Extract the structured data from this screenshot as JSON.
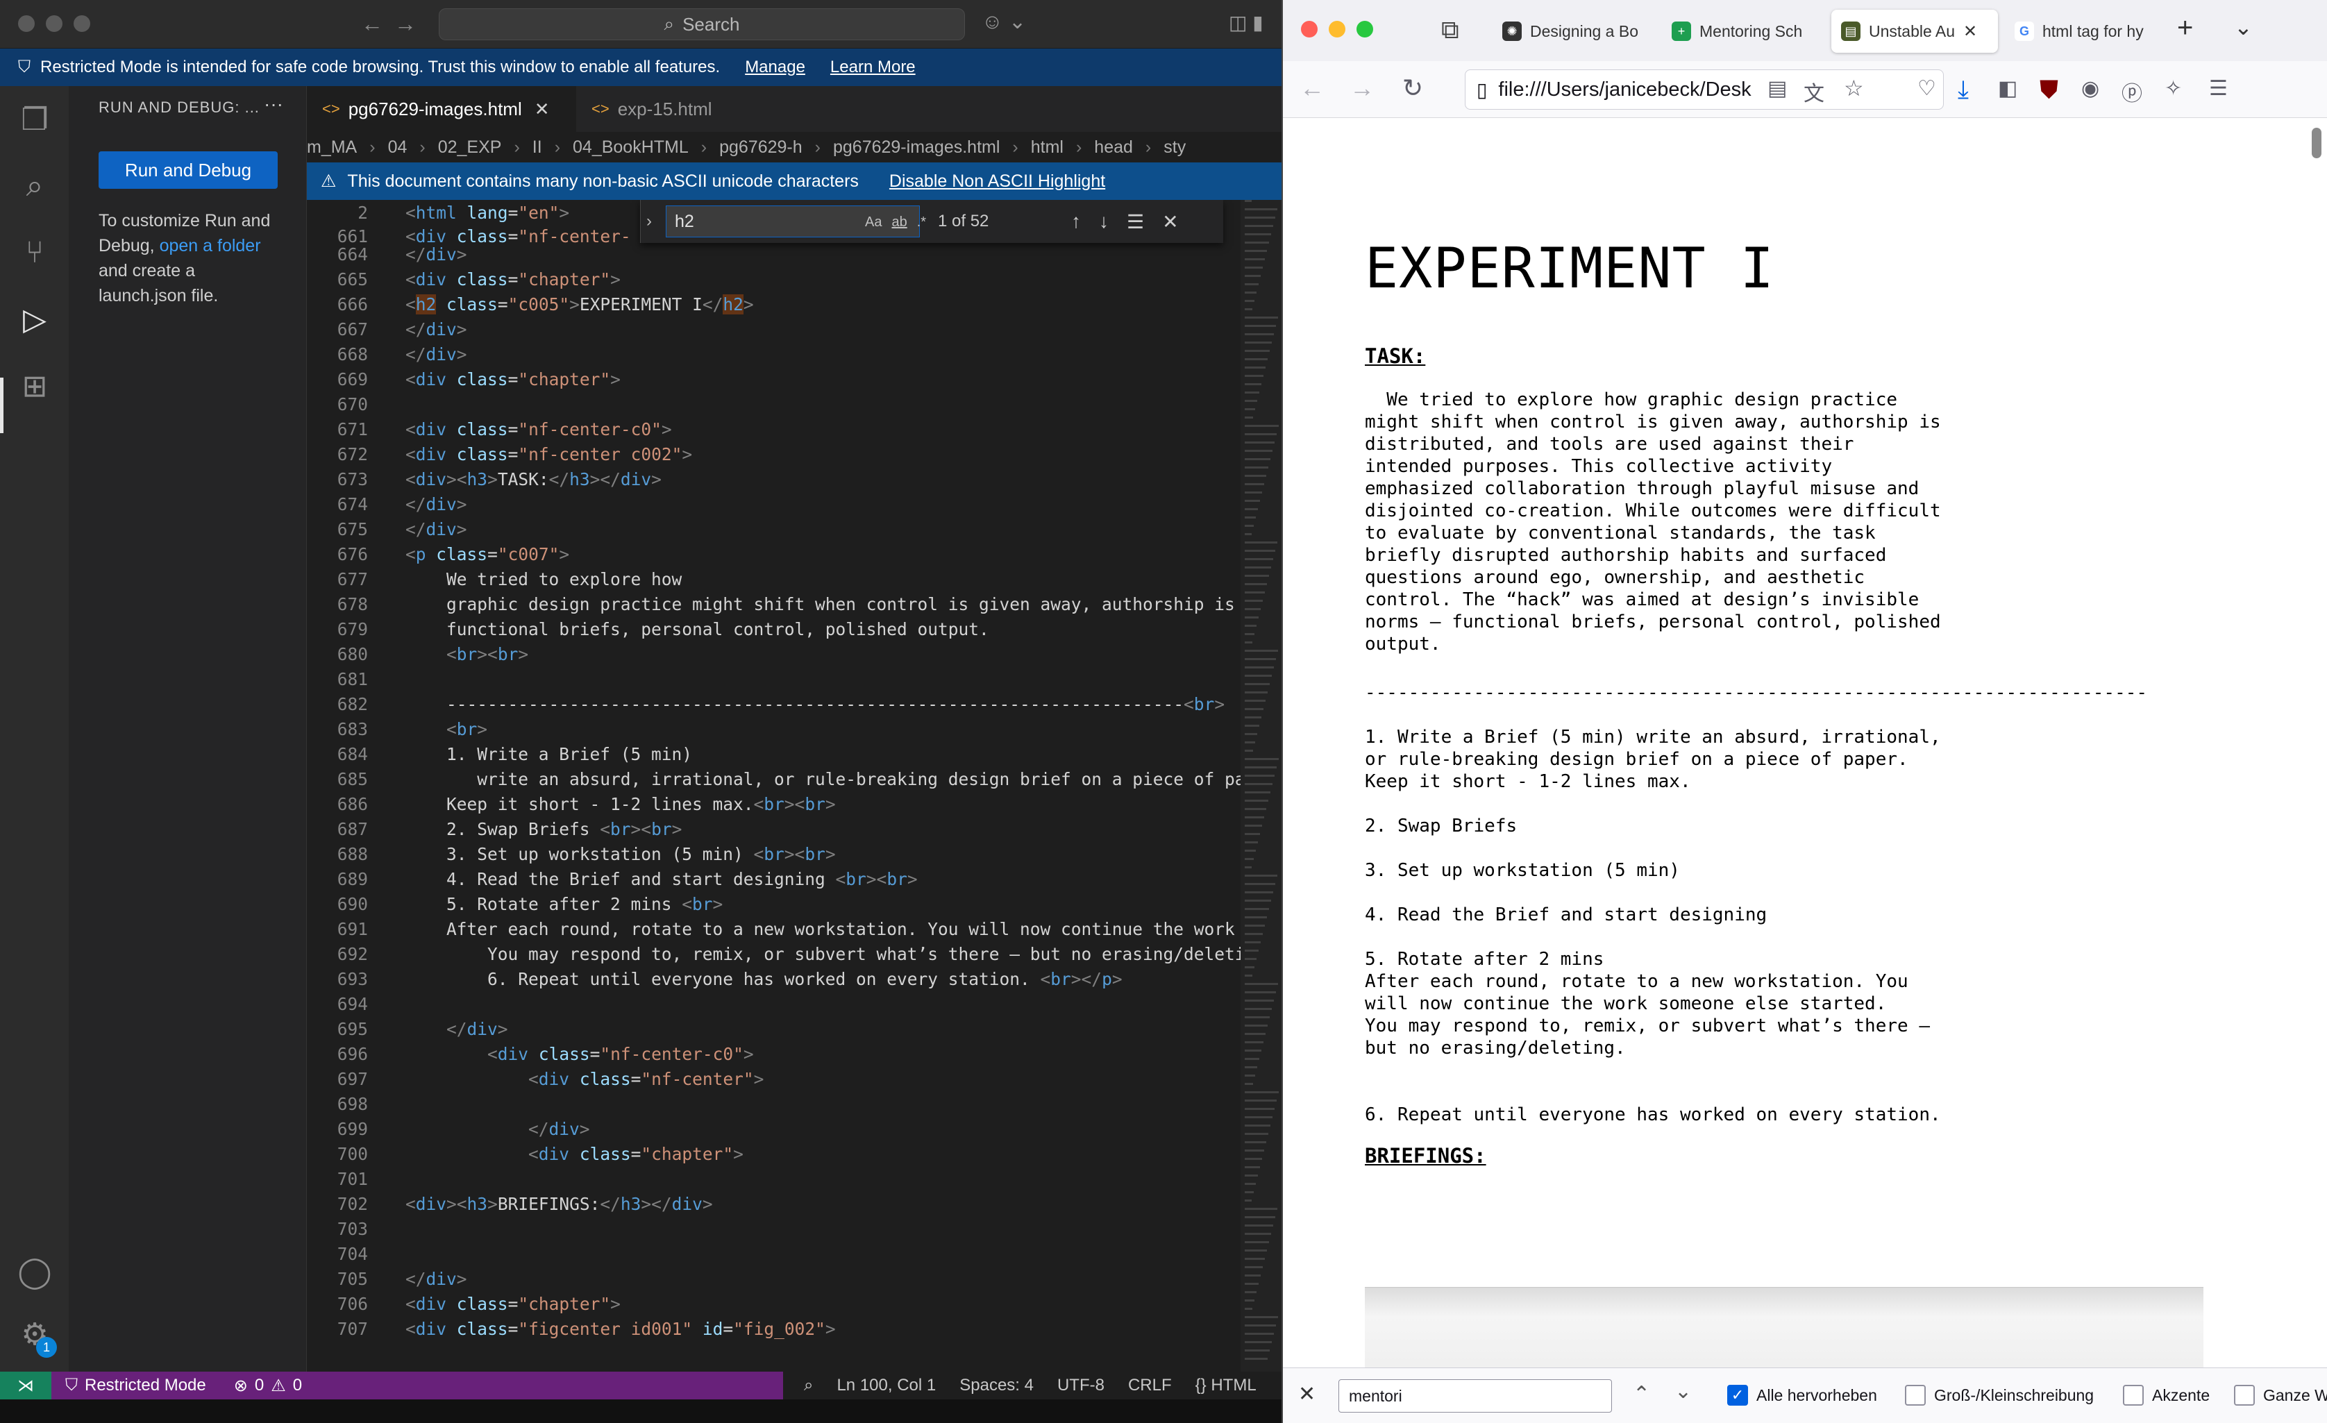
{
  "vscode": {
    "search_placeholder": "Search",
    "restricted_banner": {
      "text": "Restricted Mode is intended for safe code browsing. Trust this window to enable all features.",
      "manage": "Manage",
      "learn_more": "Learn More"
    },
    "sidebar": {
      "header": "RUN AND DEBUG: ...",
      "run_button": "Run and Debug",
      "text_part1": "To customize Run and Debug,",
      "link_open": "open a",
      "link_folder": "folder",
      "text_part2": "and create a launch.json file."
    },
    "tabs": [
      {
        "label": "pg67629-images.html"
      },
      {
        "label": "exp-15.html"
      }
    ],
    "breadcrumb": [
      "m_MA",
      "04",
      "02_EXP",
      "II",
      "04_BookHTML",
      "pg67629-h",
      "pg67629-images.html",
      "html",
      "head",
      "sty"
    ],
    "ascii_banner": {
      "text": "This document contains many non-basic ASCII unicode characters",
      "link": "Disable Non ASCII Highlight"
    },
    "find_widget": {
      "query": "h2",
      "count": "1 of 52"
    },
    "statusbar": {
      "restricted": "Restricted Mode",
      "errors": "0",
      "warnings": "0",
      "position": "Ln 100, Col 1",
      "spaces": "Spaces: 4",
      "encoding": "UTF-8",
      "eol": "CRLF",
      "language": "HTML"
    },
    "badge_count": "1",
    "code_lines": [
      {
        "n": "2",
        "html": "<span class='tg'>&lt;</span><span class='tn'>html</span> <span class='at'>lang</span>=<span class='st'>\"en\"</span><span class='tg'>&gt;</span>"
      },
      {
        "n": "661",
        "html": "<span class='tg'>&lt;</span><span class='tn'>div</span> <span class='at'>class</span>=<span class='st'>\"nf-center-</span>"
      },
      {
        "n": "664",
        "html": "<span class='tg'>&lt;/</span><span class='tn'>div</span><span class='tg'>&gt;</span>"
      },
      {
        "n": "665",
        "html": "<span class='tg'>&lt;</span><span class='tn'>div</span> <span class='at'>class</span>=<span class='st'>\"chapter\"</span><span class='tg'>&gt;</span>"
      },
      {
        "n": "666",
        "html": "<span class='tg'>&lt;</span><span class='tn hl'>h2</span> <span class='at'>class</span>=<span class='st'>\"c005\"</span><span class='tg'>&gt;</span>EXPERIMENT I<span class='tg'>&lt;/</span><span class='tn hl'>h2</span><span class='tg'>&gt;</span>"
      },
      {
        "n": "667",
        "html": "<span class='tg'>&lt;/</span><span class='tn'>div</span><span class='tg'>&gt;</span>"
      },
      {
        "n": "668",
        "html": "<span class='tg'>&lt;/</span><span class='tn'>div</span><span class='tg'>&gt;</span>"
      },
      {
        "n": "669",
        "html": "<span class='tg'>&lt;</span><span class='tn'>div</span> <span class='at'>class</span>=<span class='st'>\"chapter\"</span><span class='tg'>&gt;</span>"
      },
      {
        "n": "670",
        "html": ""
      },
      {
        "n": "671",
        "html": "<span class='tg'>&lt;</span><span class='tn'>div</span> <span class='at'>class</span>=<span class='st'>\"nf-center-c0\"</span><span class='tg'>&gt;</span>"
      },
      {
        "n": "672",
        "html": "<span class='tg'>&lt;</span><span class='tn'>div</span> <span class='at'>class</span>=<span class='st'>\"nf-center c002\"</span><span class='tg'>&gt;</span>"
      },
      {
        "n": "673",
        "html": "<span class='tg'>&lt;</span><span class='tn'>div</span><span class='tg'>&gt;&lt;</span><span class='tn'>h3</span><span class='tg'>&gt;</span>TASK:<span class='tg'>&lt;/</span><span class='tn'>h3</span><span class='tg'>&gt;&lt;/</span><span class='tn'>div</span><span class='tg'>&gt;</span>"
      },
      {
        "n": "674",
        "html": "<span class='tg'>&lt;/</span><span class='tn'>div</span><span class='tg'>&gt;</span>"
      },
      {
        "n": "675",
        "html": "<span class='tg'>&lt;/</span><span class='tn'>div</span><span class='tg'>&gt;</span>"
      },
      {
        "n": "676",
        "html": "<span class='tg'>&lt;</span><span class='tn'>p</span> <span class='at'>class</span>=<span class='st'>\"c007\"</span><span class='tg'>&gt;</span>"
      },
      {
        "n": "677",
        "html": "    We tried to explore how"
      },
      {
        "n": "678",
        "html": "    graphic design practice might shift when control is given away, authorship is"
      },
      {
        "n": "679",
        "html": "    functional briefs, personal control, polished output."
      },
      {
        "n": "680",
        "html": "    <span class='tg'>&lt;</span><span class='tn'>br</span><span class='tg'>&gt;&lt;</span><span class='tn'>br</span><span class='tg'>&gt;</span>"
      },
      {
        "n": "681",
        "html": ""
      },
      {
        "n": "682",
        "html": "    ------------------------------------------------------------------------<span class='tg'>&lt;</span><span class='tn'>br</span><span class='tg'>&gt;</span>"
      },
      {
        "n": "683",
        "html": "    <span class='tg'>&lt;</span><span class='tn'>br</span><span class='tg'>&gt;</span>"
      },
      {
        "n": "684",
        "html": "    1. Write a Brief (5 min)"
      },
      {
        "n": "685",
        "html": "       write an absurd, irrational, or rule-breaking design brief on a piece of pa"
      },
      {
        "n": "686",
        "html": "    Keep it short - 1-2 lines max.<span class='tg'>&lt;</span><span class='tn'>br</span><span class='tg'>&gt;&lt;</span><span class='tn'>br</span><span class='tg'>&gt;</span>"
      },
      {
        "n": "687",
        "html": "    2. Swap Briefs <span class='tg'>&lt;</span><span class='tn'>br</span><span class='tg'>&gt;&lt;</span><span class='tn'>br</span><span class='tg'>&gt;</span>"
      },
      {
        "n": "688",
        "html": "    3. Set up workstation (5 min) <span class='tg'>&lt;</span><span class='tn'>br</span><span class='tg'>&gt;&lt;</span><span class='tn'>br</span><span class='tg'>&gt;</span>"
      },
      {
        "n": "689",
        "html": "    4. Read the Brief and start designing <span class='tg'>&lt;</span><span class='tn'>br</span><span class='tg'>&gt;&lt;</span><span class='tn'>br</span><span class='tg'>&gt;</span>"
      },
      {
        "n": "690",
        "html": "    5. Rotate after 2 mins <span class='tg'>&lt;</span><span class='tn'>br</span><span class='tg'>&gt;</span>"
      },
      {
        "n": "691",
        "html": "    After each round, rotate to a new workstation. You will now continue the work"
      },
      {
        "n": "692",
        "html": "        You may respond to, remix, or subvert what’s there — but no erasing/deleti"
      },
      {
        "n": "693",
        "html": "        6. Repeat until everyone has worked on every station. <span class='tg'>&lt;</span><span class='tn'>br</span><span class='tg'>&gt;&lt;/</span><span class='tn'>p</span><span class='tg'>&gt;</span>"
      },
      {
        "n": "694",
        "html": ""
      },
      {
        "n": "695",
        "html": "    <span class='tg'>&lt;/</span><span class='tn'>div</span><span class='tg'>&gt;</span>"
      },
      {
        "n": "696",
        "html": "        <span class='tg'>&lt;</span><span class='tn'>div</span> <span class='at'>class</span>=<span class='st'>\"nf-center-c0\"</span><span class='tg'>&gt;</span>"
      },
      {
        "n": "697",
        "html": "            <span class='tg'>&lt;</span><span class='tn'>div</span> <span class='at'>class</span>=<span class='st'>\"nf-center\"</span><span class='tg'>&gt;</span>"
      },
      {
        "n": "698",
        "html": ""
      },
      {
        "n": "699",
        "html": "            <span class='tg'>&lt;/</span><span class='tn'>div</span><span class='tg'>&gt;</span>"
      },
      {
        "n": "700",
        "html": "            <span class='tg'>&lt;</span><span class='tn'>div</span> <span class='at'>class</span>=<span class='st'>\"chapter\"</span><span class='tg'>&gt;</span>"
      },
      {
        "n": "701",
        "html": ""
      },
      {
        "n": "702",
        "html": "<span class='tg'>&lt;</span><span class='tn'>div</span><span class='tg'>&gt;&lt;</span><span class='tn'>h3</span><span class='tg'>&gt;</span>BRIEFINGS:<span class='tg'>&lt;/</span><span class='tn'>h3</span><span class='tg'>&gt;&lt;/</span><span class='tn'>div</span><span class='tg'>&gt;</span>"
      },
      {
        "n": "703",
        "html": ""
      },
      {
        "n": "704",
        "html": ""
      },
      {
        "n": "705",
        "html": "<span class='tg'>&lt;/</span><span class='tn'>div</span><span class='tg'>&gt;</span>"
      },
      {
        "n": "706",
        "html": "<span class='tg'>&lt;</span><span class='tn'>div</span> <span class='at'>class</span>=<span class='st'>\"chapter\"</span><span class='tg'>&gt;</span>"
      },
      {
        "n": "707",
        "html": "<span class='tg'>&lt;</span><span class='tn'>div</span> <span class='at'>class</span>=<span class='st'>\"figcenter id001\"</span> <span class='at'>id</span>=<span class='st'>\"fig_002\"</span><span class='tg'>&gt;</span>"
      }
    ]
  },
  "firefox": {
    "tabs": [
      {
        "label": "Designing a Bo",
        "icon": "openai-icon"
      },
      {
        "label": "Mentoring Sch",
        "icon": "sheets-icon"
      },
      {
        "label": "Unstable Au",
        "icon": "book-icon"
      },
      {
        "label": "html tag for hy",
        "icon": "google-icon"
      }
    ],
    "url": "file:///Users/janicebeck/Desk",
    "page": {
      "title": "EXPERIMENT I",
      "task_heading": "TASK:",
      "task_body": "  We tried to explore how graphic design practice\nmight shift when control is given away, authorship is\ndistributed, and tools are used against their\nintended purposes. This collective activity\nemphasized collaboration through playful misuse and\ndisjointed co-creation. While outcomes were difficult\nto evaluate by conventional standards, the task\nbriefly disrupted authorship habits and surfaced\nquestions around ego, ownership, and aesthetic\ncontrol. The “hack” was aimed at design’s invisible\nnorms — functional briefs, personal control, polished\noutput.",
      "divider": "------------------------------------------------------------------------",
      "step1": "1. Write a Brief (5 min) write an absurd, irrational,\nor rule-breaking design brief on a piece of paper.\nKeep it short - 1-2 lines max.",
      "step2": "2. Swap Briefs",
      "step3": "3. Set up workstation (5 min)",
      "step4": "4. Read the Brief and start designing",
      "step5": "5. Rotate after 2 mins\nAfter each round, rotate to a new workstation. You\nwill now continue the work someone else started.\nYou may respond to, remix, or subvert what’s there —\nbut no erasing/deleting.",
      "step6": "6. Repeat until everyone has worked on every station.",
      "briefings_heading": "BRIEFINGS:"
    },
    "findbar": {
      "query": "mentori",
      "highlight_all": "Alle hervorheben",
      "match_case": "Groß-/Kleinschreibung",
      "diacritics": "Akzente",
      "whole_words": "Ganze W"
    }
  }
}
